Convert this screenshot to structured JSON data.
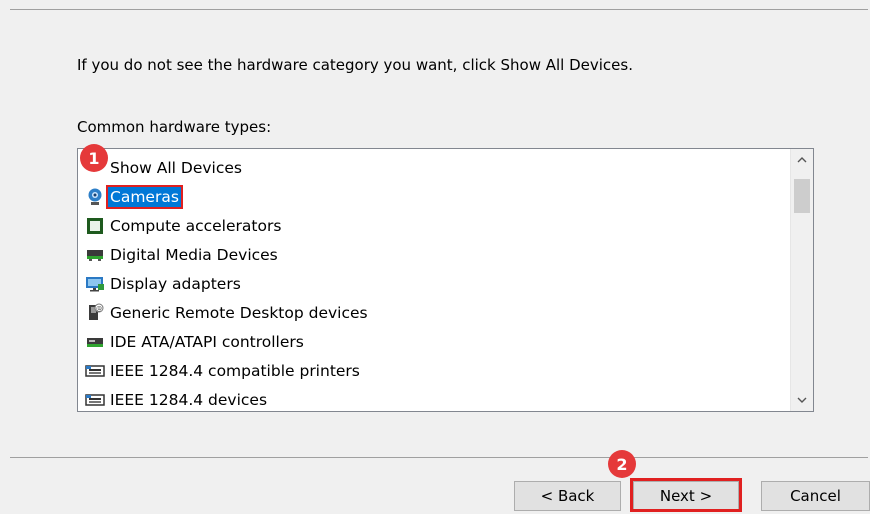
{
  "instruction": "If you do not see the hardware category you want, click Show All Devices.",
  "list_label": "Common hardware types:",
  "items": [
    {
      "label": "Show All Devices",
      "icon": "none"
    },
    {
      "label": "Cameras",
      "icon": "camera-icon",
      "selected": true
    },
    {
      "label": "Compute accelerators",
      "icon": "chip-icon"
    },
    {
      "label": "Digital Media Devices",
      "icon": "media-device-icon"
    },
    {
      "label": "Display adapters",
      "icon": "display-adapter-icon"
    },
    {
      "label": "Generic Remote Desktop devices",
      "icon": "remote-desktop-icon"
    },
    {
      "label": "IDE ATA/ATAPI controllers",
      "icon": "ide-controller-icon"
    },
    {
      "label": "IEEE 1284.4 compatible printers",
      "icon": "printer-port-icon"
    },
    {
      "label": "IEEE 1284.4 devices",
      "icon": "printer-port-icon"
    }
  ],
  "badges": {
    "step1": "1",
    "step2": "2"
  },
  "buttons": {
    "back": "< Back",
    "next": "Next >",
    "cancel": "Cancel"
  },
  "colors": {
    "selection": "#0078d7",
    "highlight": "#e02020",
    "badge": "#e5393a"
  }
}
